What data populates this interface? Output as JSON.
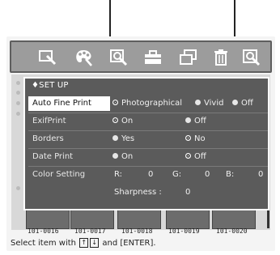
{
  "toolbar": {
    "icons": [
      "zoom-icon",
      "palette-icon",
      "magnify-icon",
      "toolbox-icon",
      "copy-icon",
      "trash-icon",
      "print-preview-icon"
    ]
  },
  "dialog": {
    "title": "♦SET UP",
    "rows": [
      {
        "label": "Auto Fine Print",
        "options": [
          "Photographical",
          "Vivid",
          "Off"
        ],
        "selected": "Photographical"
      },
      {
        "label": "ExifPrint",
        "options": [
          "On",
          "Off"
        ],
        "selected": "On"
      },
      {
        "label": "Borders",
        "options": [
          "Yes",
          "No"
        ],
        "selected": "No"
      },
      {
        "label": "Date Print",
        "options": [
          "On",
          "Off"
        ],
        "selected": "Off"
      }
    ],
    "color_setting": {
      "label": "Color Setting",
      "r_label": "R:",
      "r_value": "0",
      "g_label": "G:",
      "g_value": "0",
      "b_label": "B:",
      "b_value": "0",
      "sharpness_label": "Sharpness :",
      "sharpness_value": "0"
    }
  },
  "thumbnails": [
    "101-0016",
    "101-0017",
    "101-0018",
    "101-0019",
    "101-0020"
  ],
  "hint": {
    "prefix": "Select item with",
    "key_up": "↑",
    "key_down": "↓",
    "suffix": "and [ENTER]."
  }
}
